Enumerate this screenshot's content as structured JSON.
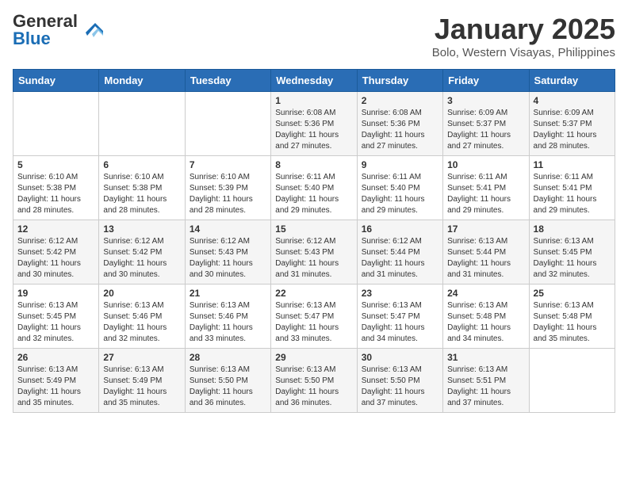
{
  "header": {
    "logo_general": "General",
    "logo_blue": "Blue",
    "month_title": "January 2025",
    "location": "Bolo, Western Visayas, Philippines"
  },
  "days_of_week": [
    "Sunday",
    "Monday",
    "Tuesday",
    "Wednesday",
    "Thursday",
    "Friday",
    "Saturday"
  ],
  "weeks": [
    [
      {
        "day": "",
        "sunrise": "",
        "sunset": "",
        "daylight": ""
      },
      {
        "day": "",
        "sunrise": "",
        "sunset": "",
        "daylight": ""
      },
      {
        "day": "",
        "sunrise": "",
        "sunset": "",
        "daylight": ""
      },
      {
        "day": "1",
        "sunrise": "Sunrise: 6:08 AM",
        "sunset": "Sunset: 5:36 PM",
        "daylight": "Daylight: 11 hours and 27 minutes."
      },
      {
        "day": "2",
        "sunrise": "Sunrise: 6:08 AM",
        "sunset": "Sunset: 5:36 PM",
        "daylight": "Daylight: 11 hours and 27 minutes."
      },
      {
        "day": "3",
        "sunrise": "Sunrise: 6:09 AM",
        "sunset": "Sunset: 5:37 PM",
        "daylight": "Daylight: 11 hours and 27 minutes."
      },
      {
        "day": "4",
        "sunrise": "Sunrise: 6:09 AM",
        "sunset": "Sunset: 5:37 PM",
        "daylight": "Daylight: 11 hours and 28 minutes."
      }
    ],
    [
      {
        "day": "5",
        "sunrise": "Sunrise: 6:10 AM",
        "sunset": "Sunset: 5:38 PM",
        "daylight": "Daylight: 11 hours and 28 minutes."
      },
      {
        "day": "6",
        "sunrise": "Sunrise: 6:10 AM",
        "sunset": "Sunset: 5:38 PM",
        "daylight": "Daylight: 11 hours and 28 minutes."
      },
      {
        "day": "7",
        "sunrise": "Sunrise: 6:10 AM",
        "sunset": "Sunset: 5:39 PM",
        "daylight": "Daylight: 11 hours and 28 minutes."
      },
      {
        "day": "8",
        "sunrise": "Sunrise: 6:11 AM",
        "sunset": "Sunset: 5:40 PM",
        "daylight": "Daylight: 11 hours and 29 minutes."
      },
      {
        "day": "9",
        "sunrise": "Sunrise: 6:11 AM",
        "sunset": "Sunset: 5:40 PM",
        "daylight": "Daylight: 11 hours and 29 minutes."
      },
      {
        "day": "10",
        "sunrise": "Sunrise: 6:11 AM",
        "sunset": "Sunset: 5:41 PM",
        "daylight": "Daylight: 11 hours and 29 minutes."
      },
      {
        "day": "11",
        "sunrise": "Sunrise: 6:11 AM",
        "sunset": "Sunset: 5:41 PM",
        "daylight": "Daylight: 11 hours and 29 minutes."
      }
    ],
    [
      {
        "day": "12",
        "sunrise": "Sunrise: 6:12 AM",
        "sunset": "Sunset: 5:42 PM",
        "daylight": "Daylight: 11 hours and 30 minutes."
      },
      {
        "day": "13",
        "sunrise": "Sunrise: 6:12 AM",
        "sunset": "Sunset: 5:42 PM",
        "daylight": "Daylight: 11 hours and 30 minutes."
      },
      {
        "day": "14",
        "sunrise": "Sunrise: 6:12 AM",
        "sunset": "Sunset: 5:43 PM",
        "daylight": "Daylight: 11 hours and 30 minutes."
      },
      {
        "day": "15",
        "sunrise": "Sunrise: 6:12 AM",
        "sunset": "Sunset: 5:43 PM",
        "daylight": "Daylight: 11 hours and 31 minutes."
      },
      {
        "day": "16",
        "sunrise": "Sunrise: 6:12 AM",
        "sunset": "Sunset: 5:44 PM",
        "daylight": "Daylight: 11 hours and 31 minutes."
      },
      {
        "day": "17",
        "sunrise": "Sunrise: 6:13 AM",
        "sunset": "Sunset: 5:44 PM",
        "daylight": "Daylight: 11 hours and 31 minutes."
      },
      {
        "day": "18",
        "sunrise": "Sunrise: 6:13 AM",
        "sunset": "Sunset: 5:45 PM",
        "daylight": "Daylight: 11 hours and 32 minutes."
      }
    ],
    [
      {
        "day": "19",
        "sunrise": "Sunrise: 6:13 AM",
        "sunset": "Sunset: 5:45 PM",
        "daylight": "Daylight: 11 hours and 32 minutes."
      },
      {
        "day": "20",
        "sunrise": "Sunrise: 6:13 AM",
        "sunset": "Sunset: 5:46 PM",
        "daylight": "Daylight: 11 hours and 32 minutes."
      },
      {
        "day": "21",
        "sunrise": "Sunrise: 6:13 AM",
        "sunset": "Sunset: 5:46 PM",
        "daylight": "Daylight: 11 hours and 33 minutes."
      },
      {
        "day": "22",
        "sunrise": "Sunrise: 6:13 AM",
        "sunset": "Sunset: 5:47 PM",
        "daylight": "Daylight: 11 hours and 33 minutes."
      },
      {
        "day": "23",
        "sunrise": "Sunrise: 6:13 AM",
        "sunset": "Sunset: 5:47 PM",
        "daylight": "Daylight: 11 hours and 34 minutes."
      },
      {
        "day": "24",
        "sunrise": "Sunrise: 6:13 AM",
        "sunset": "Sunset: 5:48 PM",
        "daylight": "Daylight: 11 hours and 34 minutes."
      },
      {
        "day": "25",
        "sunrise": "Sunrise: 6:13 AM",
        "sunset": "Sunset: 5:48 PM",
        "daylight": "Daylight: 11 hours and 35 minutes."
      }
    ],
    [
      {
        "day": "26",
        "sunrise": "Sunrise: 6:13 AM",
        "sunset": "Sunset: 5:49 PM",
        "daylight": "Daylight: 11 hours and 35 minutes."
      },
      {
        "day": "27",
        "sunrise": "Sunrise: 6:13 AM",
        "sunset": "Sunset: 5:49 PM",
        "daylight": "Daylight: 11 hours and 35 minutes."
      },
      {
        "day": "28",
        "sunrise": "Sunrise: 6:13 AM",
        "sunset": "Sunset: 5:50 PM",
        "daylight": "Daylight: 11 hours and 36 minutes."
      },
      {
        "day": "29",
        "sunrise": "Sunrise: 6:13 AM",
        "sunset": "Sunset: 5:50 PM",
        "daylight": "Daylight: 11 hours and 36 minutes."
      },
      {
        "day": "30",
        "sunrise": "Sunrise: 6:13 AM",
        "sunset": "Sunset: 5:50 PM",
        "daylight": "Daylight: 11 hours and 37 minutes."
      },
      {
        "day": "31",
        "sunrise": "Sunrise: 6:13 AM",
        "sunset": "Sunset: 5:51 PM",
        "daylight": "Daylight: 11 hours and 37 minutes."
      },
      {
        "day": "",
        "sunrise": "",
        "sunset": "",
        "daylight": ""
      }
    ]
  ]
}
